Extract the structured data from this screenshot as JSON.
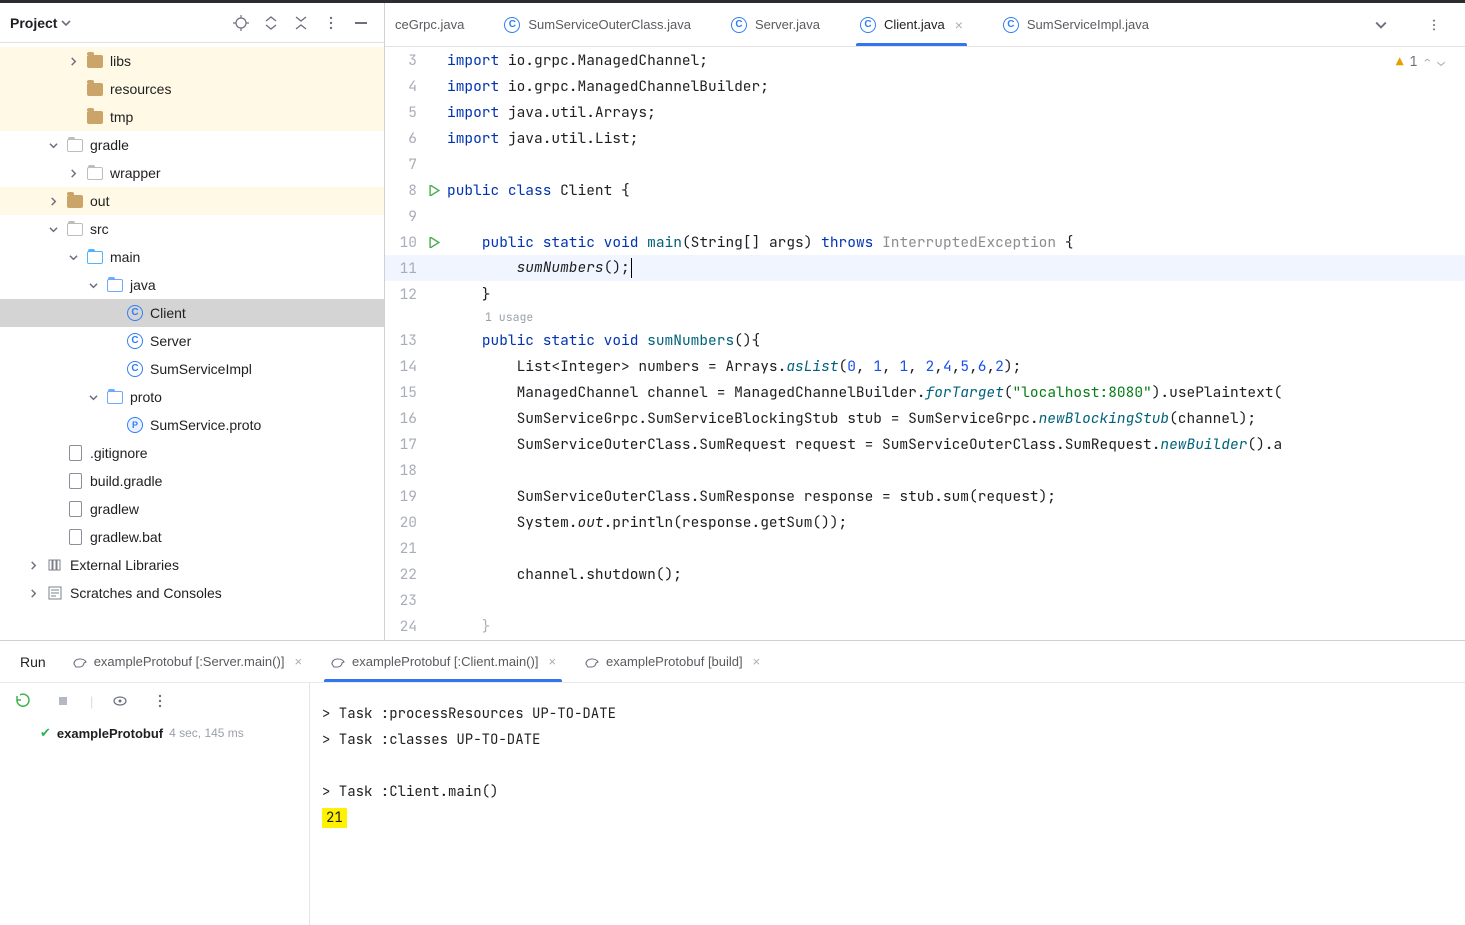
{
  "projectHeader": {
    "title": "Project"
  },
  "tree": [
    {
      "d": 3,
      "chev": "right",
      "ico": "folder",
      "label": "libs",
      "hl": true
    },
    {
      "d": 3,
      "chev": "",
      "ico": "folder",
      "label": "resources",
      "hl": true
    },
    {
      "d": 3,
      "chev": "",
      "ico": "folder",
      "label": "tmp",
      "hl": true
    },
    {
      "d": 2,
      "chev": "down",
      "ico": "folder-grey",
      "label": "gradle"
    },
    {
      "d": 3,
      "chev": "right",
      "ico": "folder-grey",
      "label": "wrapper"
    },
    {
      "d": 2,
      "chev": "right",
      "ico": "folder",
      "label": "out",
      "hl": true
    },
    {
      "d": 2,
      "chev": "down",
      "ico": "folder-grey",
      "label": "src"
    },
    {
      "d": 3,
      "chev": "down",
      "ico": "folder-src",
      "label": "main"
    },
    {
      "d": 4,
      "chev": "down",
      "ico": "folder-blue",
      "label": "java"
    },
    {
      "d": 5,
      "chev": "",
      "ico": "class",
      "label": "Client",
      "sel": true
    },
    {
      "d": 5,
      "chev": "",
      "ico": "class",
      "label": "Server"
    },
    {
      "d": 5,
      "chev": "",
      "ico": "class",
      "label": "SumServiceImpl"
    },
    {
      "d": 4,
      "chev": "down",
      "ico": "folder-blue",
      "label": "proto"
    },
    {
      "d": 5,
      "chev": "",
      "ico": "iface",
      "label": "SumService.proto"
    },
    {
      "d": 2,
      "chev": "",
      "ico": "file",
      "label": ".gitignore"
    },
    {
      "d": 2,
      "chev": "",
      "ico": "file",
      "label": "build.gradle"
    },
    {
      "d": 2,
      "chev": "",
      "ico": "file",
      "label": "gradlew"
    },
    {
      "d": 2,
      "chev": "",
      "ico": "file",
      "label": "gradlew.bat"
    },
    {
      "d": 1,
      "chev": "right",
      "ico": "lib",
      "label": "External Libraries"
    },
    {
      "d": 1,
      "chev": "right",
      "ico": "scratch",
      "label": "Scratches and Consoles"
    }
  ],
  "tabs": [
    {
      "label": "ceGrpc.java",
      "ico": "",
      "active": false,
      "close": false,
      "first": true
    },
    {
      "label": "SumServiceOuterClass.java",
      "ico": "class",
      "active": false,
      "close": false
    },
    {
      "label": "Server.java",
      "ico": "class",
      "active": false,
      "close": false
    },
    {
      "label": "Client.java",
      "ico": "class",
      "active": true,
      "close": true
    },
    {
      "label": "SumServiceImpl.java",
      "ico": "class",
      "active": false,
      "close": false
    }
  ],
  "warnings": "1",
  "usageHint": "1 usage",
  "code": [
    {
      "n": "3",
      "g": "",
      "html": "<span class='kw'>import</span> io.grpc.ManagedChannel;"
    },
    {
      "n": "4",
      "g": "",
      "html": "<span class='kw'>import</span> io.grpc.ManagedChannelBuilder;"
    },
    {
      "n": "5",
      "g": "",
      "html": "<span class='kw'>import</span> java.util.Arrays;"
    },
    {
      "n": "6",
      "g": "",
      "html": "<span class='kw'>import</span> java.util.List;"
    },
    {
      "n": "7",
      "g": "",
      "html": ""
    },
    {
      "n": "8",
      "g": "run",
      "html": "<span class='kw'>public class</span> Client {"
    },
    {
      "n": "9",
      "g": "",
      "html": ""
    },
    {
      "n": "10",
      "g": "run",
      "html": "    <span class='kw'>public static</span> <span class='kw'>void</span> <span class='fn'>main</span>(String[] args) <span class='kw'>throws</span> <span class='dim'>InterruptedException</span> {"
    },
    {
      "n": "11",
      "g": "",
      "cursor": true,
      "html": "        <span class='it'>sumNumbers</span>();<span class='caret'></span>"
    },
    {
      "n": "12",
      "g": "",
      "html": "    }"
    },
    {
      "usage": true
    },
    {
      "n": "13",
      "g": "",
      "html": "    <span class='kw'>public static</span> <span class='kw'>void</span> <span class='fn'>sumNumbers</span>(){"
    },
    {
      "n": "14",
      "g": "",
      "html": "        List&lt;Integer&gt; numbers = Arrays.<span class='call'>asList</span>(<span class='num'>0</span>, <span class='num'>1</span>, <span class='num'>1</span>, <span class='num'>2</span>,<span class='num'>4</span>,<span class='num'>5</span>,<span class='num'>6</span>,<span class='num'>2</span>);"
    },
    {
      "n": "15",
      "g": "",
      "html": "        ManagedChannel channel = ManagedChannelBuilder.<span class='call'>forTarget</span>(<span class='str'>\"localhost:8080\"</span>).usePlaintext("
    },
    {
      "n": "16",
      "g": "",
      "html": "        SumServiceGrpc.SumServiceBlockingStub stub = SumServiceGrpc.<span class='call'>newBlockingStub</span>(channel);"
    },
    {
      "n": "17",
      "g": "",
      "html": "        SumServiceOuterClass.SumRequest request = SumServiceOuterClass.SumRequest.<span class='call'>newBuilder</span>().a"
    },
    {
      "n": "18",
      "g": "",
      "html": ""
    },
    {
      "n": "19",
      "g": "",
      "html": "        SumServiceOuterClass.SumResponse response = stub.sum(request);"
    },
    {
      "n": "20",
      "g": "",
      "html": "        System.<span class='it'>out</span>.println(response.getSum());"
    },
    {
      "n": "21",
      "g": "",
      "html": ""
    },
    {
      "n": "22",
      "g": "",
      "html": "        channel.shutdown();"
    },
    {
      "n": "23",
      "g": "",
      "html": ""
    },
    {
      "n": "24",
      "g": "",
      "html": "    }",
      "faded": true
    }
  ],
  "run": {
    "label": "Run",
    "tabs": [
      {
        "label": "exampleProtobuf [:Server.main()]",
        "active": false,
        "close": true
      },
      {
        "label": "exampleProtobuf [:Client.main()]",
        "active": true,
        "close": true
      },
      {
        "label": "exampleProtobuf [build]",
        "active": false,
        "close": true
      }
    ],
    "status": {
      "name": "exampleProtobuf",
      "time": "4 sec, 145 ms"
    },
    "outputLines": [
      "> Task :processResources UP-TO-DATE",
      "> Task :classes UP-TO-DATE",
      "",
      "> Task :Client.main()"
    ],
    "highlightedResult": "21"
  }
}
